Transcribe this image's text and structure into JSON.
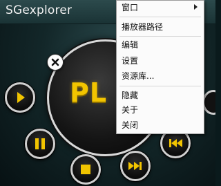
{
  "app": {
    "title": "SGexplorer"
  },
  "player": {
    "display_text": "PL"
  },
  "context_menu": {
    "items": [
      {
        "label": "窗口",
        "has_submenu": true
      },
      {
        "label": "播放器路径"
      },
      {
        "label": "编辑"
      },
      {
        "label": "设置"
      },
      {
        "label": "资源库..."
      },
      {
        "label": "隐藏"
      },
      {
        "label": "关于"
      },
      {
        "label": "关闭"
      }
    ]
  },
  "icons": {
    "close": "close-icon",
    "play": "play-icon",
    "pause": "pause-icon",
    "stop": "stop-icon",
    "next": "next-track-icon",
    "previous": "previous-track-icon"
  },
  "colors": {
    "accent": "#f2c400",
    "ring": "#cfcfcf",
    "background": "#132729"
  }
}
